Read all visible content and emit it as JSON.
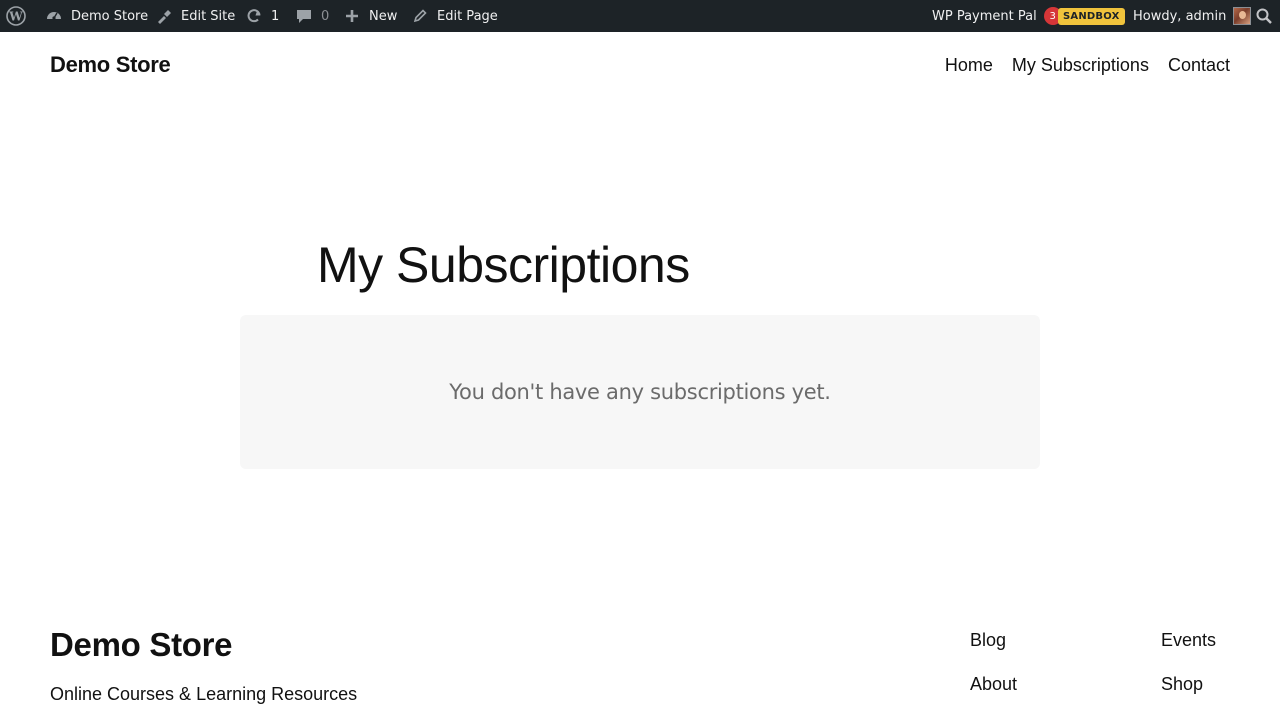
{
  "admin_bar": {
    "wp_logo_icon": "wordpress-icon",
    "site_name": "Demo Store",
    "edit_site": "Edit Site",
    "updates_count": "1",
    "comments_count": "0",
    "new_label": "New",
    "edit_page": "Edit Page",
    "plugin_name": "WP Payment Pal",
    "plugin_count": "3",
    "sandbox_label": "SANDBOX",
    "howdy": "Howdy, admin"
  },
  "header": {
    "site_title": "Demo Store",
    "nav": [
      "Home",
      "My Subscriptions",
      "Contact"
    ]
  },
  "main": {
    "page_title": "My Subscriptions",
    "empty_message": "You don't have any subscriptions yet."
  },
  "footer": {
    "site_title": "Demo Store",
    "tagline": "Online Courses & Learning Resources",
    "links_col1": [
      "Blog",
      "About"
    ],
    "links_col2": [
      "Events",
      "Shop"
    ]
  },
  "colors": {
    "admin_bar_bg": "#1d2327",
    "count_badge": "#d63638",
    "sandbox_badge": "#f0c33c",
    "notice_bg": "#f7f7f7"
  }
}
